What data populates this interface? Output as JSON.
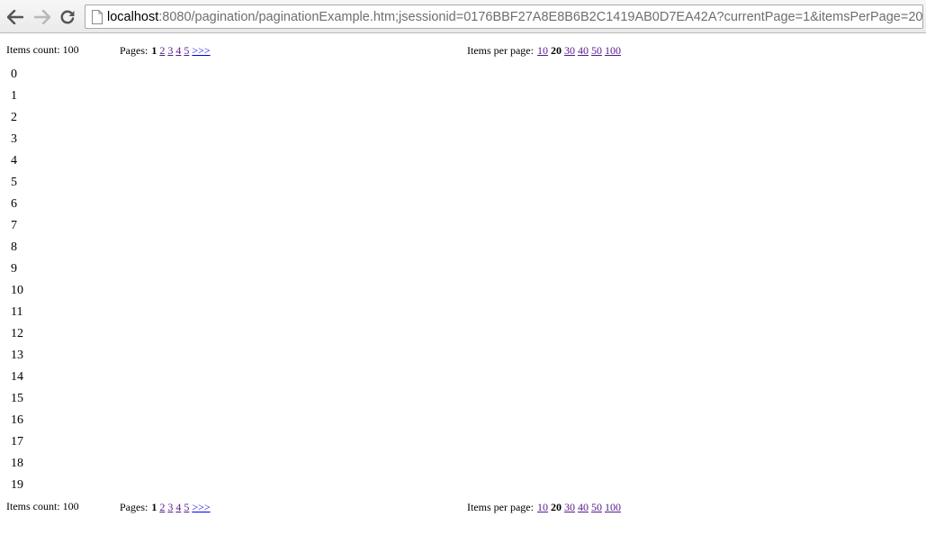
{
  "browser": {
    "url_host": "localhost",
    "url_rest": ":8080/pagination/paginationExample.htm;jsessionid=0176BBF27A8E8B6B2C1419AB0D7EA42A?currentPage=1&itemsPerPage=20"
  },
  "pager": {
    "items_count_label": "Items count: 100",
    "pages_label": "Pages:",
    "current_page": "1",
    "page_links": [
      "2",
      "3",
      "4",
      "5"
    ],
    "next_label": ">>>",
    "ipp_label": "Items per page:",
    "ipp_before": [
      "10"
    ],
    "ipp_current": "20",
    "ipp_after": [
      "30",
      "40",
      "50",
      "100"
    ]
  },
  "items": [
    "0",
    "1",
    "2",
    "3",
    "4",
    "5",
    "6",
    "7",
    "8",
    "9",
    "10",
    "11",
    "12",
    "13",
    "14",
    "15",
    "16",
    "17",
    "18",
    "19"
  ]
}
